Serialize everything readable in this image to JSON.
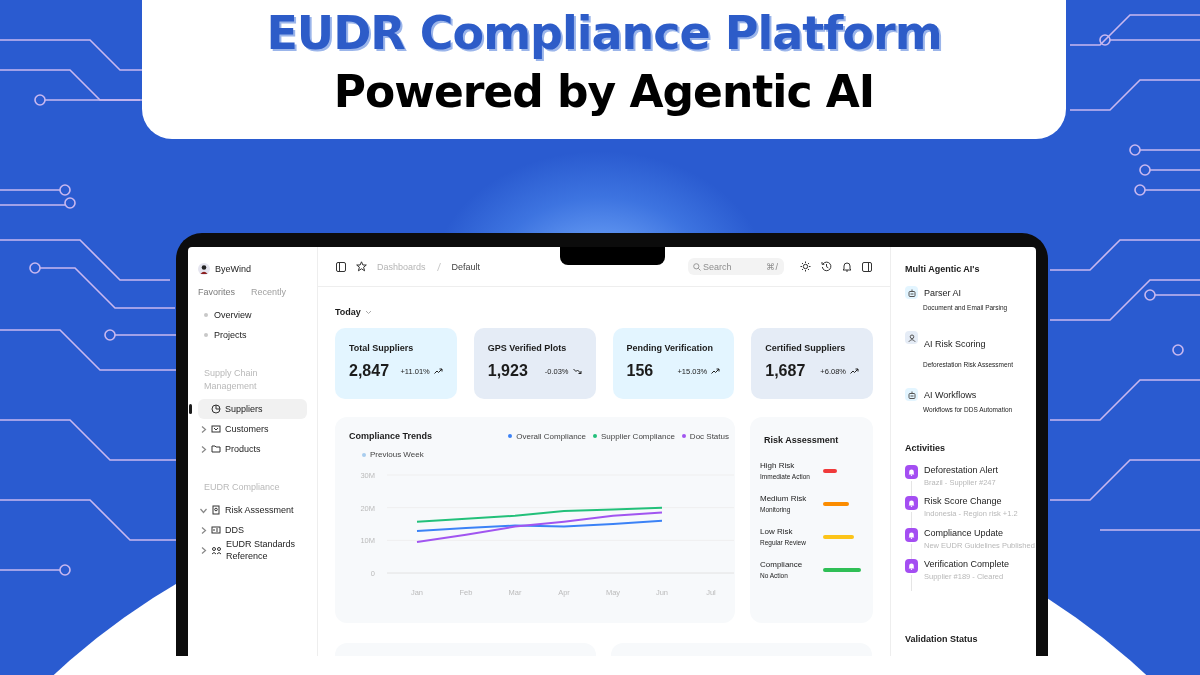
{
  "banner": {
    "title": "EUDR Compliance Platform",
    "subtitle": "Powered by Agentic AI"
  },
  "sidebar": {
    "user": "ByeWind",
    "tabs": [
      {
        "label": "Favorites",
        "selected": true
      },
      {
        "label": "Recently",
        "selected": false
      }
    ],
    "favorites": [
      "Overview",
      "Projects"
    ],
    "sections": [
      {
        "title": "Supply Chain Management",
        "items": [
          {
            "label": "Suppliers",
            "selected": true
          },
          {
            "label": "Customers",
            "selected": false,
            "expanded": false
          },
          {
            "label": "Products",
            "selected": false,
            "expanded": false
          }
        ]
      },
      {
        "title": "EUDR Compliance",
        "items": [
          {
            "label": "Risk Assessment",
            "selected": false,
            "expanded": true
          },
          {
            "label": "DDS",
            "selected": false,
            "expanded": false
          },
          {
            "label": "EUDR Standards Reference",
            "selected": false,
            "expanded": false
          }
        ]
      }
    ]
  },
  "topbar": {
    "breadcrumb": [
      "Dashboards",
      "Default"
    ],
    "search": {
      "placeholder": "Search",
      "shortcut": "⌘/"
    }
  },
  "period": "Today",
  "stats": [
    {
      "label": "Total Suppliers",
      "value": "2,847",
      "change": "+11.01%",
      "kind": "up",
      "color": "#e3f5ff"
    },
    {
      "label": "GPS Verified Plots",
      "value": "1,923",
      "change": "-0.03%",
      "kind": "down",
      "color": "#e5ecf6"
    },
    {
      "label": "Pending Verification",
      "value": "156",
      "change": "+15.03%",
      "kind": "up",
      "color": "#e3f5ff"
    },
    {
      "label": "Certified Suppliers",
      "value": "1,687",
      "change": "+6.08%",
      "kind": "up",
      "color": "#e5ecf6"
    }
  ],
  "trends": {
    "title": "Compliance Trends",
    "chart_data": {
      "type": "line",
      "categories": [
        "Jan",
        "Feb",
        "Mar",
        "Apr",
        "May",
        "Jun",
        "Jul"
      ],
      "ylim": [
        0,
        30
      ],
      "yticks": [
        {
          "value": 0,
          "label": "0"
        },
        {
          "value": 10,
          "label": "10M"
        },
        {
          "value": 20,
          "label": "20M"
        },
        {
          "value": 30,
          "label": "30M"
        }
      ],
      "series": [
        {
          "name": "Overall Compliance",
          "color": "#3b82f6",
          "values": [
            12.9,
            13.8,
            14.5,
            14.2,
            15.0,
            16.0,
            null
          ]
        },
        {
          "name": "Supplier Compliance",
          "color": "#22c07a",
          "values": [
            15.7,
            16.6,
            17.5,
            19.0,
            19.4,
            20.0,
            null
          ]
        },
        {
          "name": "Doc Status",
          "color": "#a155f0",
          "values": [
            9.5,
            11.7,
            14.2,
            15.7,
            17.5,
            18.5,
            null
          ]
        },
        {
          "name": "Previous Week",
          "color": "#a8cdee",
          "values": [
            null,
            null,
            null,
            null,
            null,
            null,
            null
          ]
        }
      ]
    }
  },
  "risk": {
    "title": "Risk Assessment",
    "items": [
      {
        "label": "High Risk",
        "note": "Immediate Action",
        "color": "#f03a3a"
      },
      {
        "label": "Medium Risk",
        "note": "Monitoring",
        "color": "#fb8c00"
      },
      {
        "label": "Low Risk",
        "note": "Regular Review",
        "color": "#fcc419"
      },
      {
        "label": "Compliance",
        "note": "No Action",
        "color": "#2fbf56"
      }
    ]
  },
  "agents": {
    "title": "Multi Agentic AI's",
    "items": [
      {
        "name": "Parser AI",
        "note": "Document and Email Parsing"
      },
      {
        "name": "AI Risk Scoring",
        "note": "Deforestation Risk Assessment"
      },
      {
        "name": "AI Workflows",
        "note": "Workflows for DDS Automation"
      }
    ]
  },
  "activities": {
    "title": "Activities",
    "items": [
      {
        "title": "Deforestation Alert",
        "note": "Brazil - Supplier #247"
      },
      {
        "title": "Risk Score Change",
        "note": "Indonesia - Region risk +1.2"
      },
      {
        "title": "Compliance Update",
        "note": "New EUDR Guidelines Published"
      },
      {
        "title": "Verification Complete",
        "note": "Supplier #189 - Cleared"
      }
    ]
  },
  "validation": {
    "title": "Validation Status"
  }
}
